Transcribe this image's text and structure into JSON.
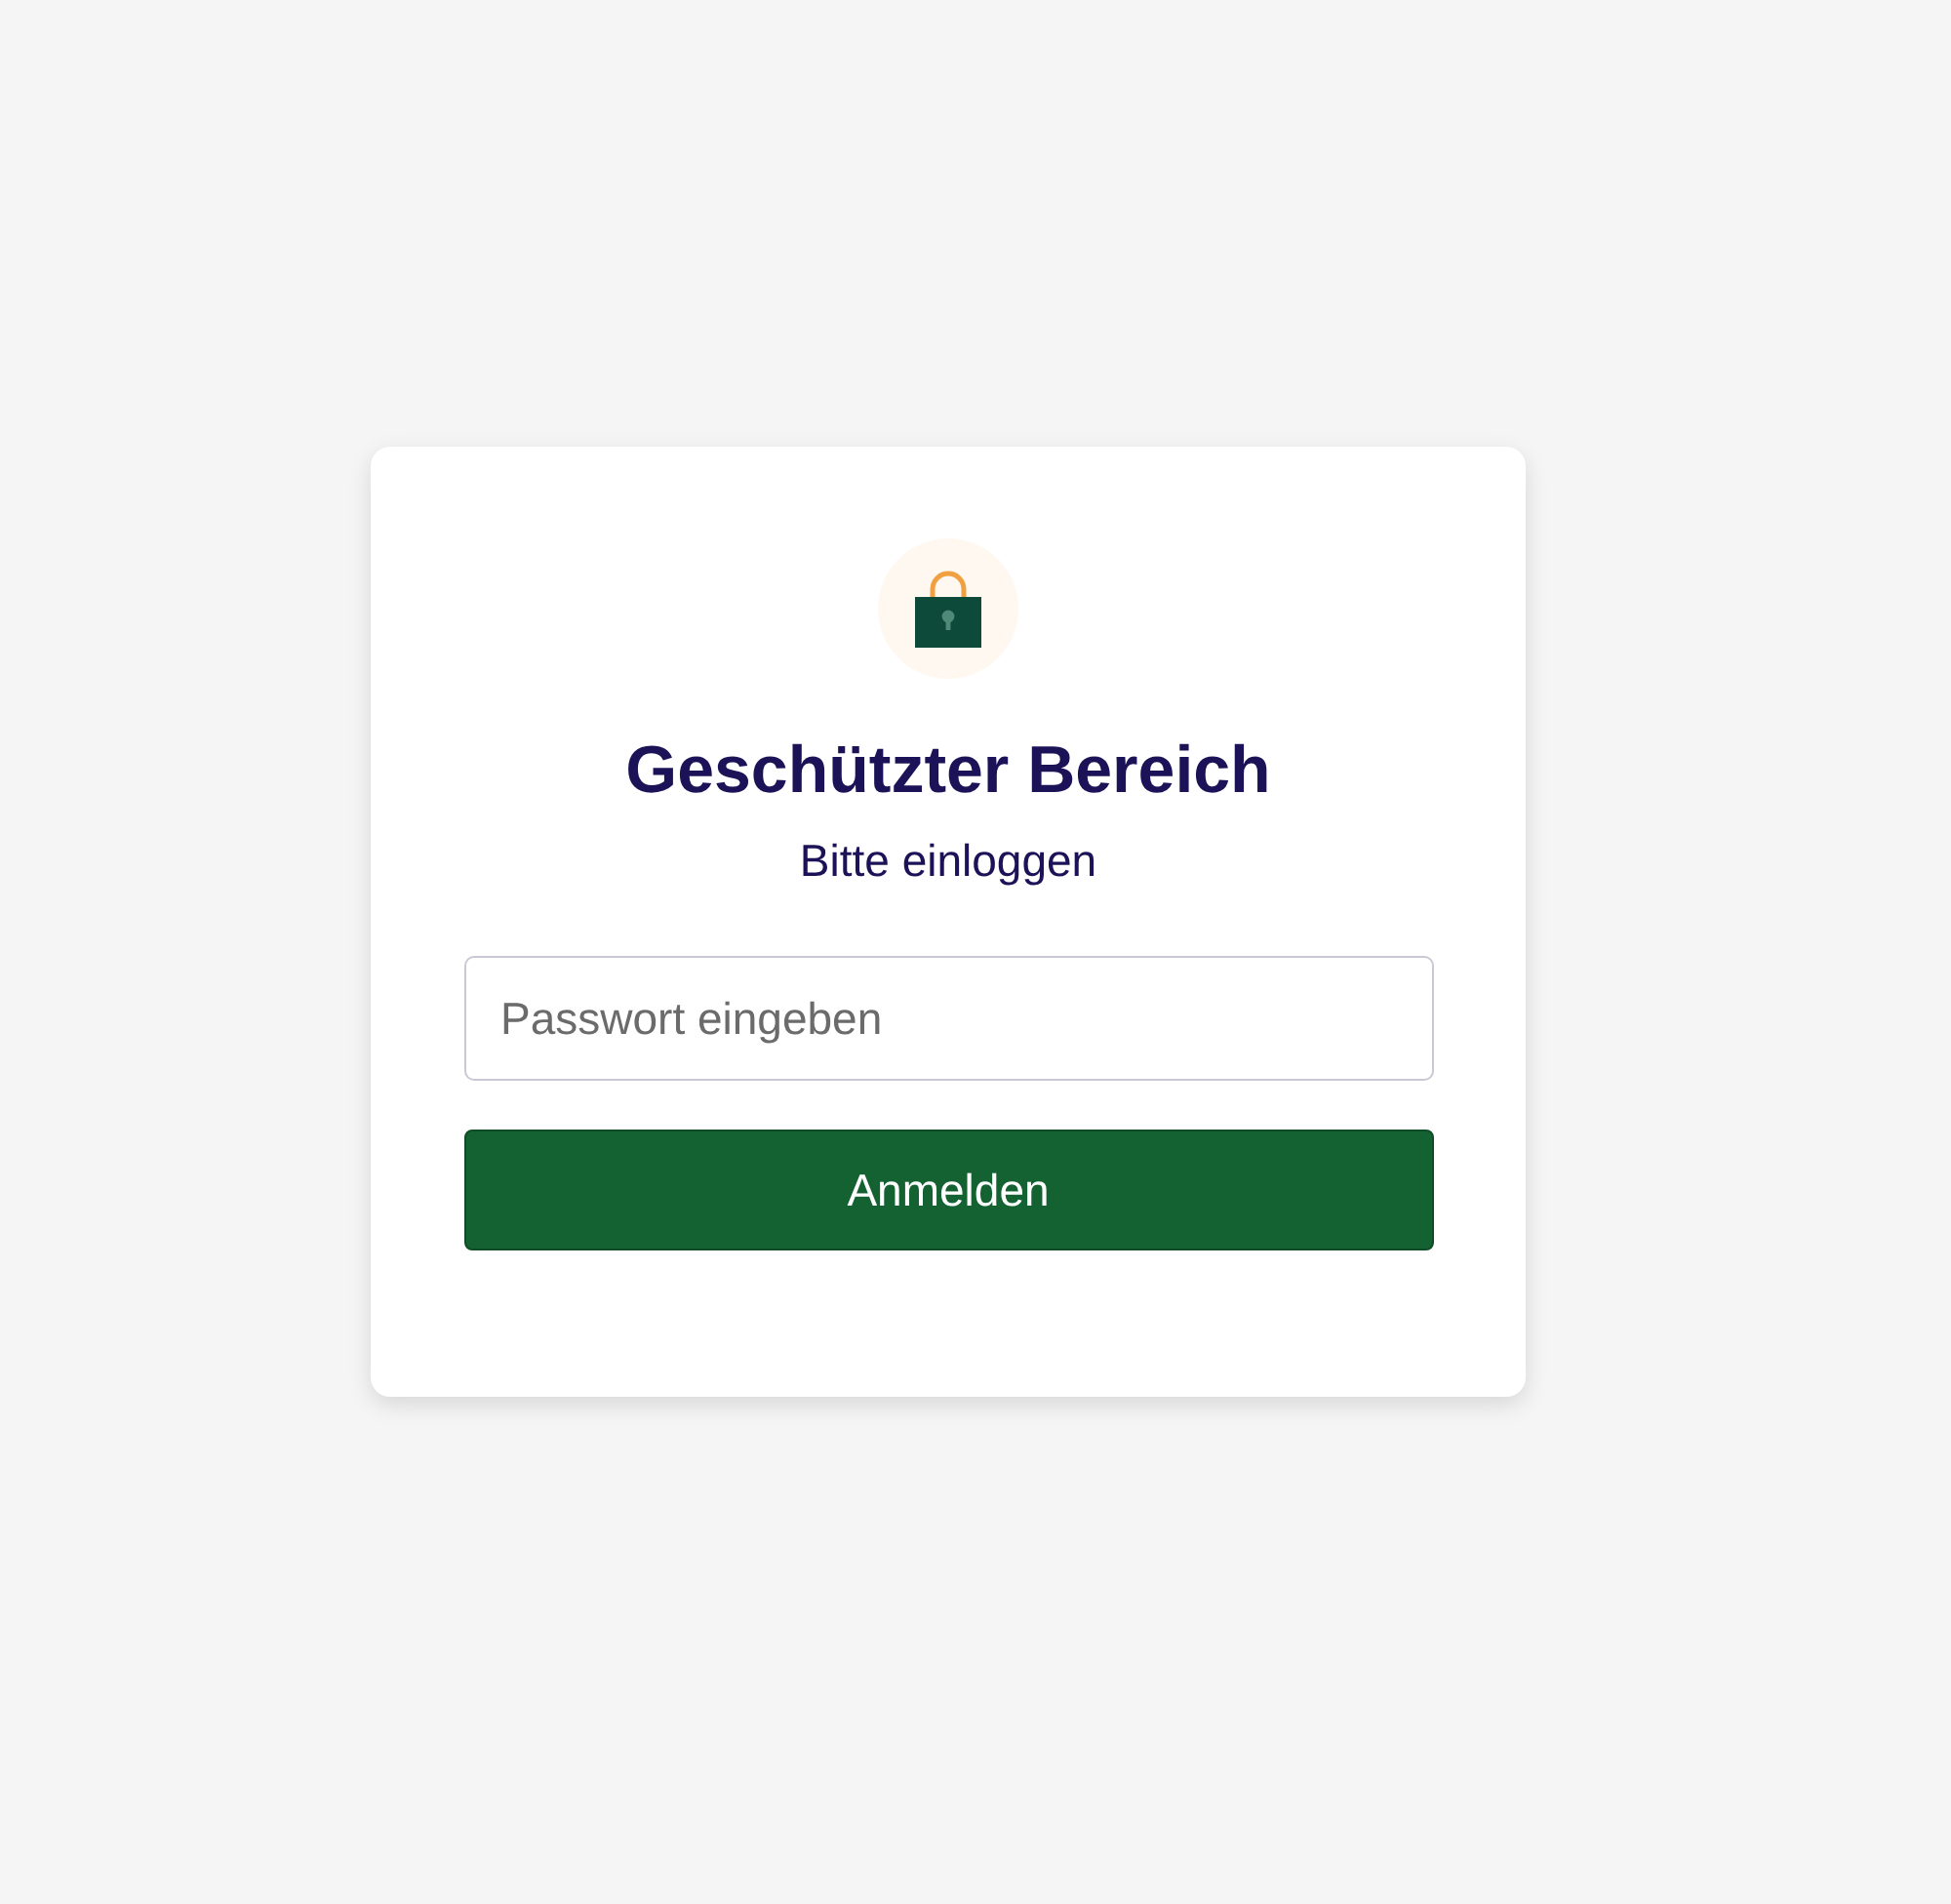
{
  "login_card": {
    "title": "Geschützter Bereich",
    "subtitle": "Bitte einloggen",
    "password_field": {
      "placeholder": "Passwort eingeben"
    },
    "submit_button": {
      "label": "Anmelden"
    }
  }
}
